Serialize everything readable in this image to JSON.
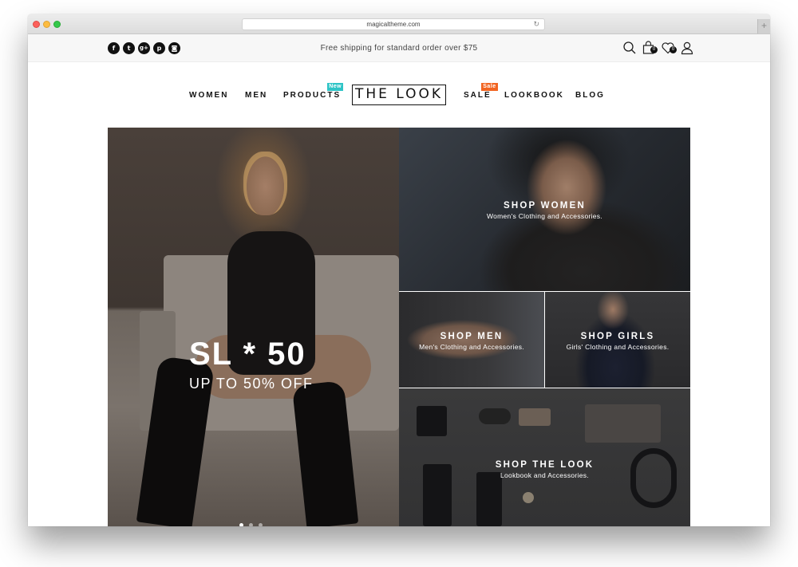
{
  "browser": {
    "url": "magicaltheme.com",
    "new_tab_label": "+",
    "reload_icon": "reload-icon"
  },
  "topbar": {
    "social": [
      {
        "name": "facebook-icon",
        "glyph": "f"
      },
      {
        "name": "twitter-icon",
        "glyph": "t"
      },
      {
        "name": "google-plus-icon",
        "glyph": "g+"
      },
      {
        "name": "pinterest-icon",
        "glyph": "p"
      },
      {
        "name": "instagram-icon",
        "glyph": "◙"
      }
    ],
    "shipping_text": "Free shipping for standard order over $75",
    "cart_count": "0",
    "wishlist_count": "0"
  },
  "nav": {
    "items": [
      {
        "label": "WOMEN"
      },
      {
        "label": "MEN"
      },
      {
        "label": "PRODUCTS",
        "tag": "New"
      },
      {
        "label": "SALE",
        "tag": "Sale"
      },
      {
        "label": "LOOKBOOK"
      },
      {
        "label": "BLOG"
      }
    ],
    "logo": "THE LOOK",
    "colors": {
      "new_tag": "#2ec4c6",
      "sale_tag": "#f26522"
    }
  },
  "hero": {
    "promo_title": "SL * 50",
    "promo_subtitle": "UP TO 50% OFF",
    "slider": {
      "total": 3,
      "active": 1
    }
  },
  "panels": {
    "women": {
      "title": "SHOP WOMEN",
      "desc": "Women's Clothing and Accessories."
    },
    "men": {
      "title": "SHOP MEN",
      "desc": "Men's Clothing and Accessories."
    },
    "girls": {
      "title": "SHOP GIRLS",
      "desc": "Girls' Clothing and Accessories."
    },
    "look": {
      "title": "SHOP THE LOOK",
      "desc": "Lookbook and Accessories."
    }
  }
}
